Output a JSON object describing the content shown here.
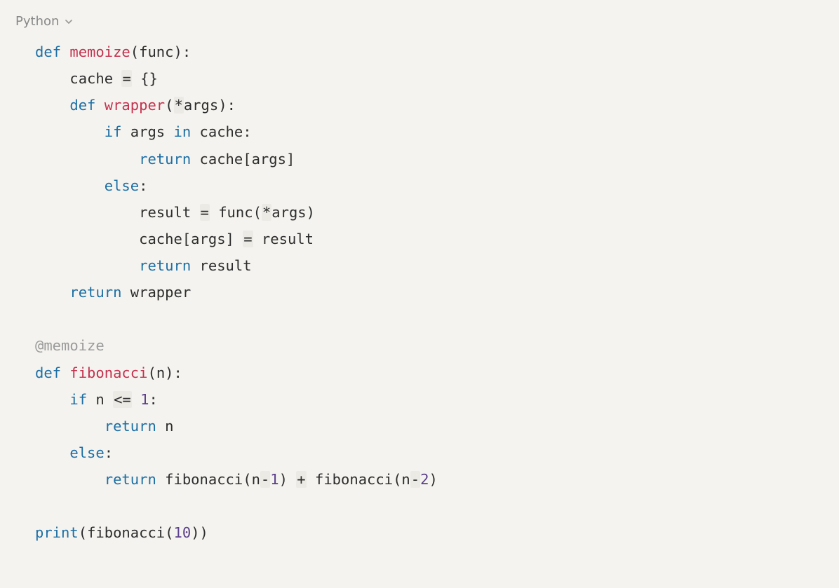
{
  "language_selector": {
    "label": "Python"
  },
  "code": {
    "lines": [
      {
        "indent": 0,
        "tokens": [
          {
            "cls": "tok-keyword",
            "t": "def"
          },
          {
            "cls": "tok-text",
            "t": " "
          },
          {
            "cls": "tok-def",
            "t": "memoize"
          },
          {
            "cls": "tok-parens",
            "t": "("
          },
          {
            "cls": "tok-text",
            "t": "func"
          },
          {
            "cls": "tok-parens",
            "t": ")"
          },
          {
            "cls": "tok-text",
            "t": ":"
          }
        ]
      },
      {
        "indent": 1,
        "tokens": [
          {
            "cls": "tok-text",
            "t": "cache "
          },
          {
            "cls": "tok-op",
            "t": "="
          },
          {
            "cls": "tok-text",
            "t": " "
          },
          {
            "cls": "tok-parens",
            "t": "{}"
          }
        ]
      },
      {
        "indent": 1,
        "tokens": [
          {
            "cls": "tok-keyword",
            "t": "def"
          },
          {
            "cls": "tok-text",
            "t": " "
          },
          {
            "cls": "tok-def",
            "t": "wrapper"
          },
          {
            "cls": "tok-parens",
            "t": "("
          },
          {
            "cls": "tok-op",
            "t": "*"
          },
          {
            "cls": "tok-text",
            "t": "args"
          },
          {
            "cls": "tok-parens",
            "t": ")"
          },
          {
            "cls": "tok-text",
            "t": ":"
          }
        ]
      },
      {
        "indent": 2,
        "tokens": [
          {
            "cls": "tok-keyword",
            "t": "if"
          },
          {
            "cls": "tok-text",
            "t": " args "
          },
          {
            "cls": "tok-keyword",
            "t": "in"
          },
          {
            "cls": "tok-text",
            "t": " cache:"
          }
        ]
      },
      {
        "indent": 3,
        "tokens": [
          {
            "cls": "tok-keyword",
            "t": "return"
          },
          {
            "cls": "tok-text",
            "t": " cache"
          },
          {
            "cls": "tok-parens",
            "t": "["
          },
          {
            "cls": "tok-text",
            "t": "args"
          },
          {
            "cls": "tok-parens",
            "t": "]"
          }
        ]
      },
      {
        "indent": 2,
        "tokens": [
          {
            "cls": "tok-keyword",
            "t": "else"
          },
          {
            "cls": "tok-text",
            "t": ":"
          }
        ]
      },
      {
        "indent": 3,
        "tokens": [
          {
            "cls": "tok-text",
            "t": "result "
          },
          {
            "cls": "tok-op",
            "t": "="
          },
          {
            "cls": "tok-text",
            "t": " func"
          },
          {
            "cls": "tok-parens",
            "t": "("
          },
          {
            "cls": "tok-op",
            "t": "*"
          },
          {
            "cls": "tok-text",
            "t": "args"
          },
          {
            "cls": "tok-parens",
            "t": ")"
          }
        ]
      },
      {
        "indent": 3,
        "tokens": [
          {
            "cls": "tok-text",
            "t": "cache"
          },
          {
            "cls": "tok-parens",
            "t": "["
          },
          {
            "cls": "tok-text",
            "t": "args"
          },
          {
            "cls": "tok-parens",
            "t": "]"
          },
          {
            "cls": "tok-text",
            "t": " "
          },
          {
            "cls": "tok-op",
            "t": "="
          },
          {
            "cls": "tok-text",
            "t": " result"
          }
        ]
      },
      {
        "indent": 3,
        "tokens": [
          {
            "cls": "tok-keyword",
            "t": "return"
          },
          {
            "cls": "tok-text",
            "t": " result"
          }
        ]
      },
      {
        "indent": 1,
        "tokens": [
          {
            "cls": "tok-keyword",
            "t": "return"
          },
          {
            "cls": "tok-text",
            "t": " wrapper"
          }
        ]
      },
      {
        "indent": 0,
        "tokens": []
      },
      {
        "indent": 0,
        "tokens": [
          {
            "cls": "tok-decorator",
            "t": "@memoize"
          }
        ]
      },
      {
        "indent": 0,
        "tokens": [
          {
            "cls": "tok-keyword",
            "t": "def"
          },
          {
            "cls": "tok-text",
            "t": " "
          },
          {
            "cls": "tok-def",
            "t": "fibonacci"
          },
          {
            "cls": "tok-parens",
            "t": "("
          },
          {
            "cls": "tok-text",
            "t": "n"
          },
          {
            "cls": "tok-parens",
            "t": ")"
          },
          {
            "cls": "tok-text",
            "t": ":"
          }
        ]
      },
      {
        "indent": 1,
        "tokens": [
          {
            "cls": "tok-keyword",
            "t": "if"
          },
          {
            "cls": "tok-text",
            "t": " n "
          },
          {
            "cls": "tok-op",
            "t": "<="
          },
          {
            "cls": "tok-text",
            "t": " "
          },
          {
            "cls": "tok-number",
            "t": "1"
          },
          {
            "cls": "tok-text",
            "t": ":"
          }
        ]
      },
      {
        "indent": 2,
        "tokens": [
          {
            "cls": "tok-keyword",
            "t": "return"
          },
          {
            "cls": "tok-text",
            "t": " n"
          }
        ]
      },
      {
        "indent": 1,
        "tokens": [
          {
            "cls": "tok-keyword",
            "t": "else"
          },
          {
            "cls": "tok-text",
            "t": ":"
          }
        ]
      },
      {
        "indent": 2,
        "tokens": [
          {
            "cls": "tok-keyword",
            "t": "return"
          },
          {
            "cls": "tok-text",
            "t": " fibonacci"
          },
          {
            "cls": "tok-parens",
            "t": "("
          },
          {
            "cls": "tok-text",
            "t": "n"
          },
          {
            "cls": "tok-op",
            "t": "-"
          },
          {
            "cls": "tok-number",
            "t": "1"
          },
          {
            "cls": "tok-parens",
            "t": ")"
          },
          {
            "cls": "tok-text",
            "t": " "
          },
          {
            "cls": "tok-op",
            "t": "+"
          },
          {
            "cls": "tok-text",
            "t": " fibonacci"
          },
          {
            "cls": "tok-parens",
            "t": "("
          },
          {
            "cls": "tok-text",
            "t": "n"
          },
          {
            "cls": "tok-op",
            "t": "-"
          },
          {
            "cls": "tok-number",
            "t": "2"
          },
          {
            "cls": "tok-parens",
            "t": ")"
          }
        ]
      },
      {
        "indent": 0,
        "tokens": []
      },
      {
        "indent": 0,
        "tokens": [
          {
            "cls": "tok-call",
            "t": "print"
          },
          {
            "cls": "tok-parens",
            "t": "("
          },
          {
            "cls": "tok-text",
            "t": "fibonacci"
          },
          {
            "cls": "tok-parens",
            "t": "("
          },
          {
            "cls": "tok-number",
            "t": "10"
          },
          {
            "cls": "tok-parens",
            "t": ")"
          },
          {
            "cls": "tok-parens",
            "t": ")"
          }
        ]
      }
    ]
  }
}
